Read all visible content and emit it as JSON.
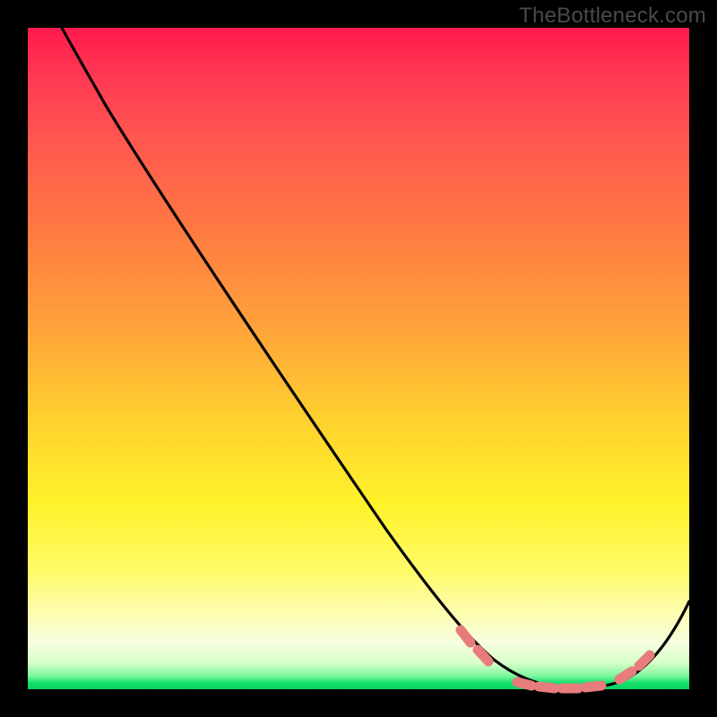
{
  "watermark": "TheBottleneck.com",
  "chart_data": {
    "type": "line",
    "title": "",
    "xlabel": "",
    "ylabel": "",
    "xlim": [
      0,
      100
    ],
    "ylim": [
      0,
      100
    ],
    "series": [
      {
        "name": "bottleneck-curve",
        "x": [
          0,
          5,
          10,
          15,
          20,
          25,
          30,
          35,
          40,
          45,
          50,
          55,
          60,
          65,
          68,
          72,
          76,
          80,
          84,
          88,
          92,
          96,
          100
        ],
        "values": [
          100,
          97,
          93,
          88,
          82,
          75,
          68,
          60,
          52,
          44,
          36,
          28,
          20,
          12,
          7,
          3,
          1,
          0,
          0,
          1,
          4,
          10,
          18
        ],
        "color": "#000000"
      }
    ],
    "markers": {
      "name": "highlight-segments",
      "color": "#e87c7c",
      "points": [
        {
          "x": 65,
          "y": 12
        },
        {
          "x": 67,
          "y": 9
        },
        {
          "x": 74,
          "y": 2
        },
        {
          "x": 78,
          "y": 0.5
        },
        {
          "x": 82,
          "y": 0
        },
        {
          "x": 86,
          "y": 0.5
        },
        {
          "x": 89,
          "y": 1.5
        },
        {
          "x": 91,
          "y": 3
        }
      ]
    },
    "gradient_bands": [
      {
        "color": "#ff1a4d",
        "stop": 0
      },
      {
        "color": "#ff7842",
        "stop": 30
      },
      {
        "color": "#ffd32e",
        "stop": 60
      },
      {
        "color": "#fdfdb5",
        "stop": 89
      },
      {
        "color": "#18e06e",
        "stop": 99
      }
    ]
  }
}
